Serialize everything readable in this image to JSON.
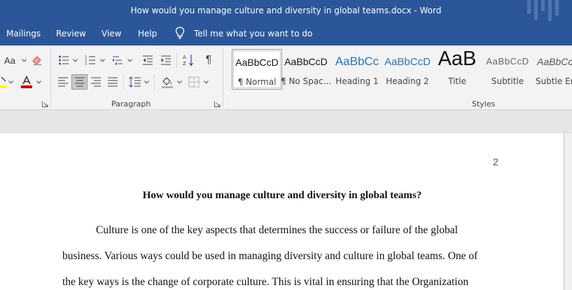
{
  "window": {
    "title": "How would you manage culture and diversity in global teams.docx  -  Word"
  },
  "menu": {
    "tabs": [
      "Mailings",
      "Review",
      "View",
      "Help"
    ],
    "tell_me": "Tell me what you want to do"
  },
  "ribbon": {
    "font_size_label": "Aa",
    "paragraph_group_label": "Paragraph",
    "styles_group_label": "Styles",
    "styles": [
      {
        "preview": "AaBbCcD",
        "name": "¶ Normal",
        "selected": true
      },
      {
        "preview": "AaBbCcD",
        "name": "¶ No Spac...",
        "selected": false
      },
      {
        "preview": "AaBbCc",
        "name": "Heading 1",
        "selected": false
      },
      {
        "preview": "AaBbCcD",
        "name": "Heading 2",
        "selected": false
      },
      {
        "preview": "AaB",
        "name": "Title",
        "selected": false
      },
      {
        "preview": "AaBbCcD",
        "name": "Subtitle",
        "selected": false
      },
      {
        "preview": "AaBbCcl",
        "name": "Subtle Em",
        "selected": false
      }
    ],
    "colors": {
      "highlight": "#ffff00",
      "font_color": "#c00000",
      "accent": "#2b579a",
      "heading_blue": "#2e74b5"
    }
  },
  "document": {
    "page_number": "2",
    "heading": "How would you manage culture and diversity in global teams?",
    "lines": [
      "Culture is one of the key aspects that determines the success or failure of the global",
      "business. Various ways could be used in managing diversity and culture in global teams. One of",
      "the key ways is the change of corporate culture. This is vital in ensuring that the Organization"
    ]
  }
}
